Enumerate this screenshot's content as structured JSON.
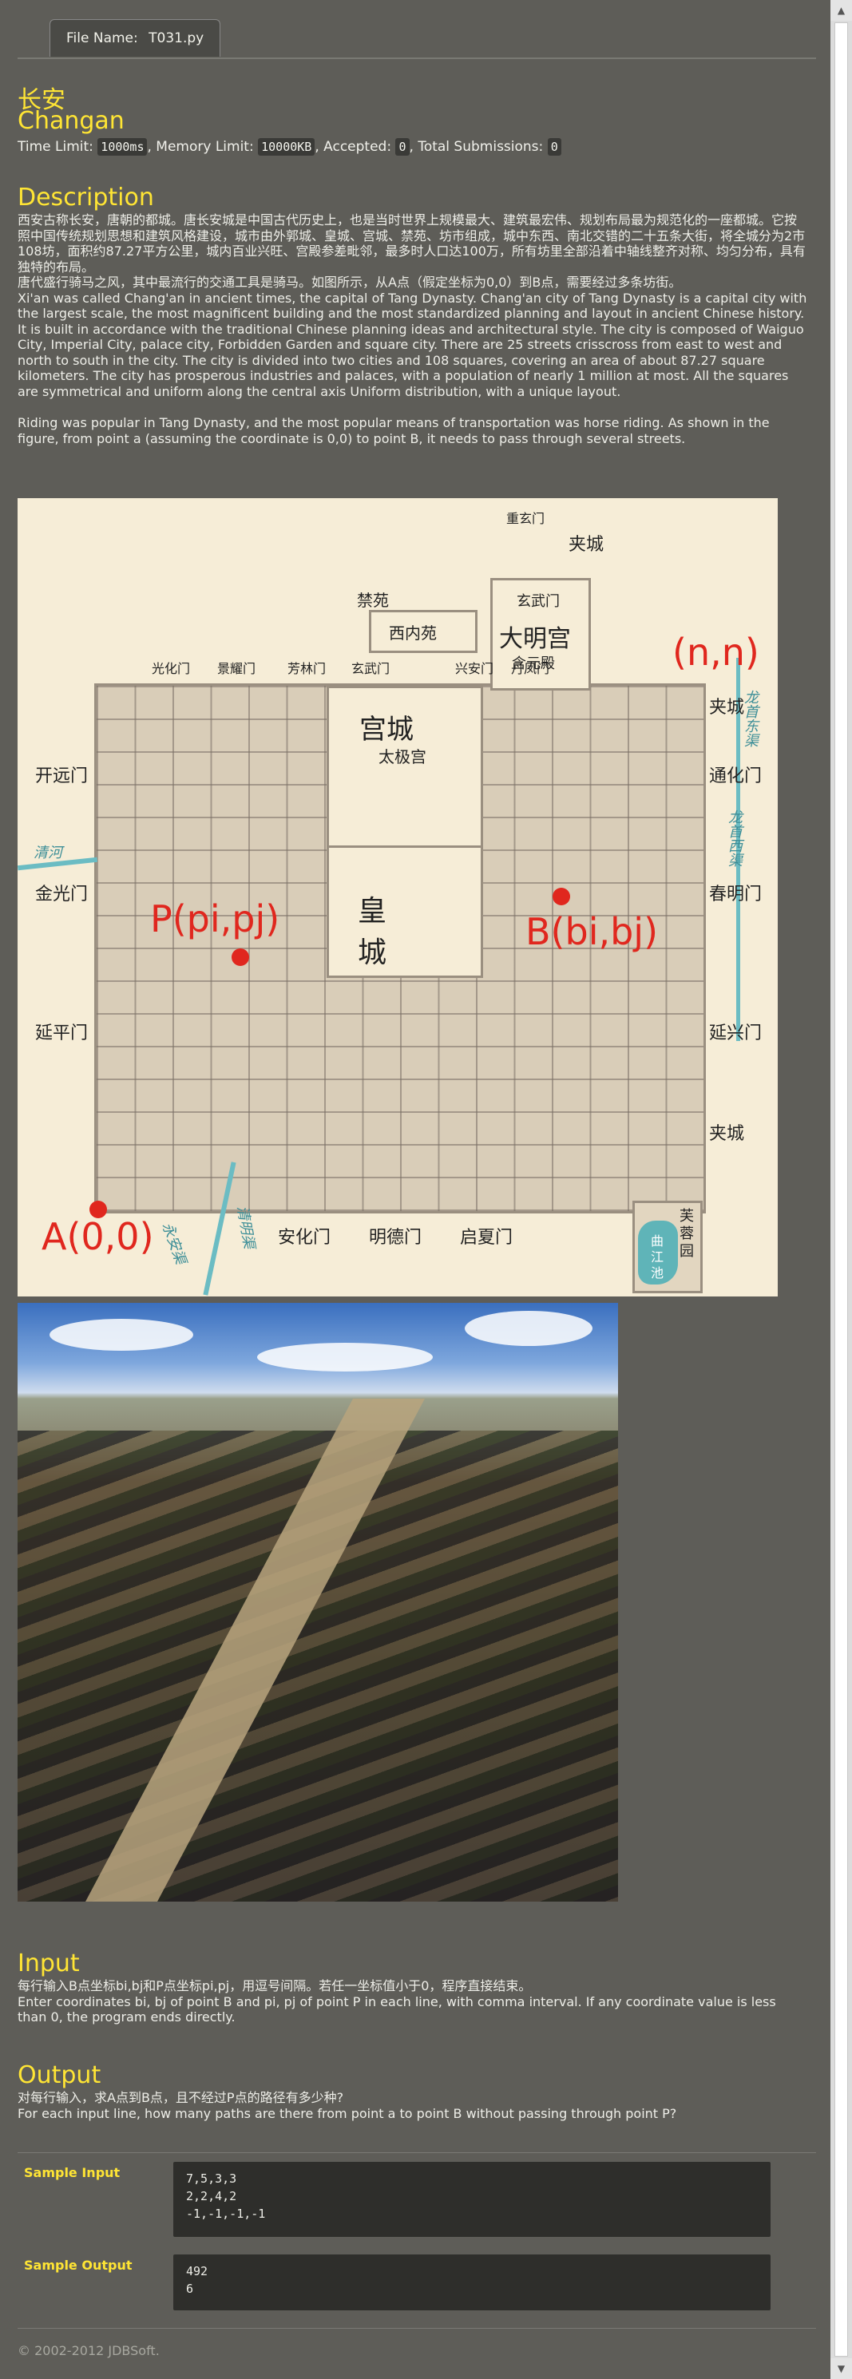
{
  "file_tab": {
    "label": "File Name:",
    "filename": "T031.py"
  },
  "title_cn": "长安",
  "title_en": "Changan",
  "limits": {
    "time_limit_label": "Time Limit:",
    "time_limit": "1000ms",
    "memory_limit_label": ", Memory Limit:",
    "memory_limit": "10000KB",
    "accepted_label": ", Accepted:",
    "accepted": "0",
    "submissions_label": ", Total Submissions:",
    "submissions": "0"
  },
  "description": {
    "heading": "Description",
    "p1_cn": "西安古称长安，唐朝的都城。唐长安城是中国古代历史上，也是当时世界上规模最大、建筑最宏伟、规划布局最为规范化的一座都城。它按照中国传统规划思想和建筑风格建设，城市由外郭城、皇城、宫城、禁苑、坊市组成，城中东西、南北交错的二十五条大街，将全城分为2市108坊，面积约87.27平方公里，城内百业兴旺、宫殿参差毗邻，最多时人口达100万，所有坊里全部沿着中轴线整齐对称、均匀分布，具有独特的布局。",
    "p2_cn": "唐代盛行骑马之风，其中最流行的交通工具是骑马。如图所示，从A点（假定坐标为0,0）到B点，需要经过多条坊街。",
    "p1_en": "Xi'an was called Chang'an in ancient times, the capital of Tang Dynasty. Chang'an city of Tang Dynasty is a capital city with the largest scale, the most magnificent building and the most standardized planning and layout in ancient Chinese history. It is built in accordance with the traditional Chinese planning ideas and architectural style. The city is composed of Waiguo City, Imperial City, palace city, Forbidden Garden and square city. There are 25 streets crisscross from east to west and north to south in the city. The city is divided into two cities and 108 squares, covering an area of about 87.27 square kilometers. The city has prosperous industries and palaces, with a population of nearly 1 million at most. All the squares are symmetrical and uniform along the central axis Uniform distribution, with a unique layout.",
    "p2_en": "Riding was popular in Tang Dynasty, and the most popular means of transportation was horse riding. As shown in the figure, from point a (assuming the coordinate is 0,0) to point B, it needs to pass through several streets."
  },
  "map": {
    "point_a": "A(0,0)",
    "point_b": "B(bi,bj)",
    "point_p": "P(pi,pj)",
    "corner": "(n,n)",
    "palace_city": "宫城",
    "taiji": "太极宫",
    "imperial_city": "皇 城",
    "daming": "大明宫",
    "xuanwu": "玄武门",
    "hanyuan": "含元殿",
    "xineiyuan": "西内苑",
    "jinyuan": "禁苑",
    "furong": "芙蓉园",
    "qujiang": "曲江池",
    "gates": {
      "kaiyuan": "开远门",
      "jinguang": "金光门",
      "yanping": "延平门",
      "tonghua": "通化门",
      "chunming": "春明门",
      "yanxing": "延兴门",
      "anhua": "安化门",
      "mingde": "明德门",
      "qixia": "启夏门",
      "guanghua": "光化门",
      "jingyao": "景耀门",
      "fanglin": "芳林门",
      "xuanwu2": "玄武门",
      "xingan": "兴安门",
      "danfeng": "丹凤门",
      "chongxuan": "重玄门",
      "jiacheng_n": "夹城",
      "jiacheng_e": "夹城",
      "jiacheng_s": "夹城"
    },
    "rivers": {
      "qing": "清河",
      "yongan": "永安渠",
      "longshou_e": "龙首东渠",
      "longshou_w": "龙首西渠",
      "qingming": "清明渠"
    }
  },
  "input": {
    "heading": "Input",
    "cn": "每行输入B点坐标bi,bj和P点坐标pi,pj，用逗号间隔。若任一坐标值小于0，程序直接结束。",
    "en": "Enter coordinates bi, bj of point B and pi, pj of point P in each line, with comma interval. If any coordinate value is less than 0, the program ends directly."
  },
  "output": {
    "heading": "Output",
    "cn": "对每行输入，求A点到B点，且不经过P点的路径有多少种?",
    "en": "For each input line, how many paths are there from point a to point B without passing through point P?"
  },
  "sample_input": {
    "label": "Sample Input",
    "lines": "7,5,3,3\n2,2,4,2\n-1,-1,-1,-1"
  },
  "sample_output": {
    "label": "Sample Output",
    "lines": "492\n6"
  },
  "footer": "© 2002-2012  JDBSoft."
}
